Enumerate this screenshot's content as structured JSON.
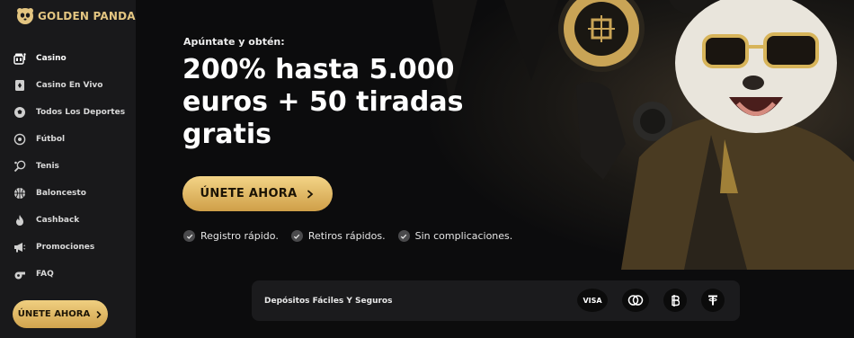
{
  "brand": {
    "name": "GOLDEN PANDA",
    "accent": "#e3c581"
  },
  "sidebar": {
    "items": [
      {
        "label": "Casino",
        "icon": "slot-machine-icon"
      },
      {
        "label": "Casino En Vivo",
        "icon": "playing-card-icon"
      },
      {
        "label": "Todos Los Deportes",
        "icon": "soccer-ball-icon"
      },
      {
        "label": "Fútbol",
        "icon": "football-icon"
      },
      {
        "label": "Tenis",
        "icon": "tennis-racket-icon"
      },
      {
        "label": "Baloncesto",
        "icon": "basketball-icon"
      },
      {
        "label": "Cashback",
        "icon": "fire-icon"
      },
      {
        "label": "Promociones",
        "icon": "megaphone-icon"
      },
      {
        "label": "FAQ",
        "icon": "whistle-icon"
      }
    ],
    "cta_label": "ÚNETE AHORA"
  },
  "hero": {
    "eyebrow": "Apúntate y obtén:",
    "headline": "200% hasta 5.000 euros + 50 tiradas gratis",
    "cta_label": "ÚNETE AHORA",
    "benefits": [
      "Registro rápido.",
      "Retiros rápidos.",
      "Sin complicaciones."
    ]
  },
  "payments": {
    "label": "Depósitos Fáciles Y Seguros",
    "methods": [
      {
        "name": "VISA",
        "icon": "visa-icon"
      },
      {
        "name": "Mastercard",
        "icon": "mastercard-icon"
      },
      {
        "name": "Bitcoin",
        "icon": "bitcoin-icon"
      },
      {
        "name": "Tether",
        "icon": "tether-icon"
      }
    ]
  }
}
